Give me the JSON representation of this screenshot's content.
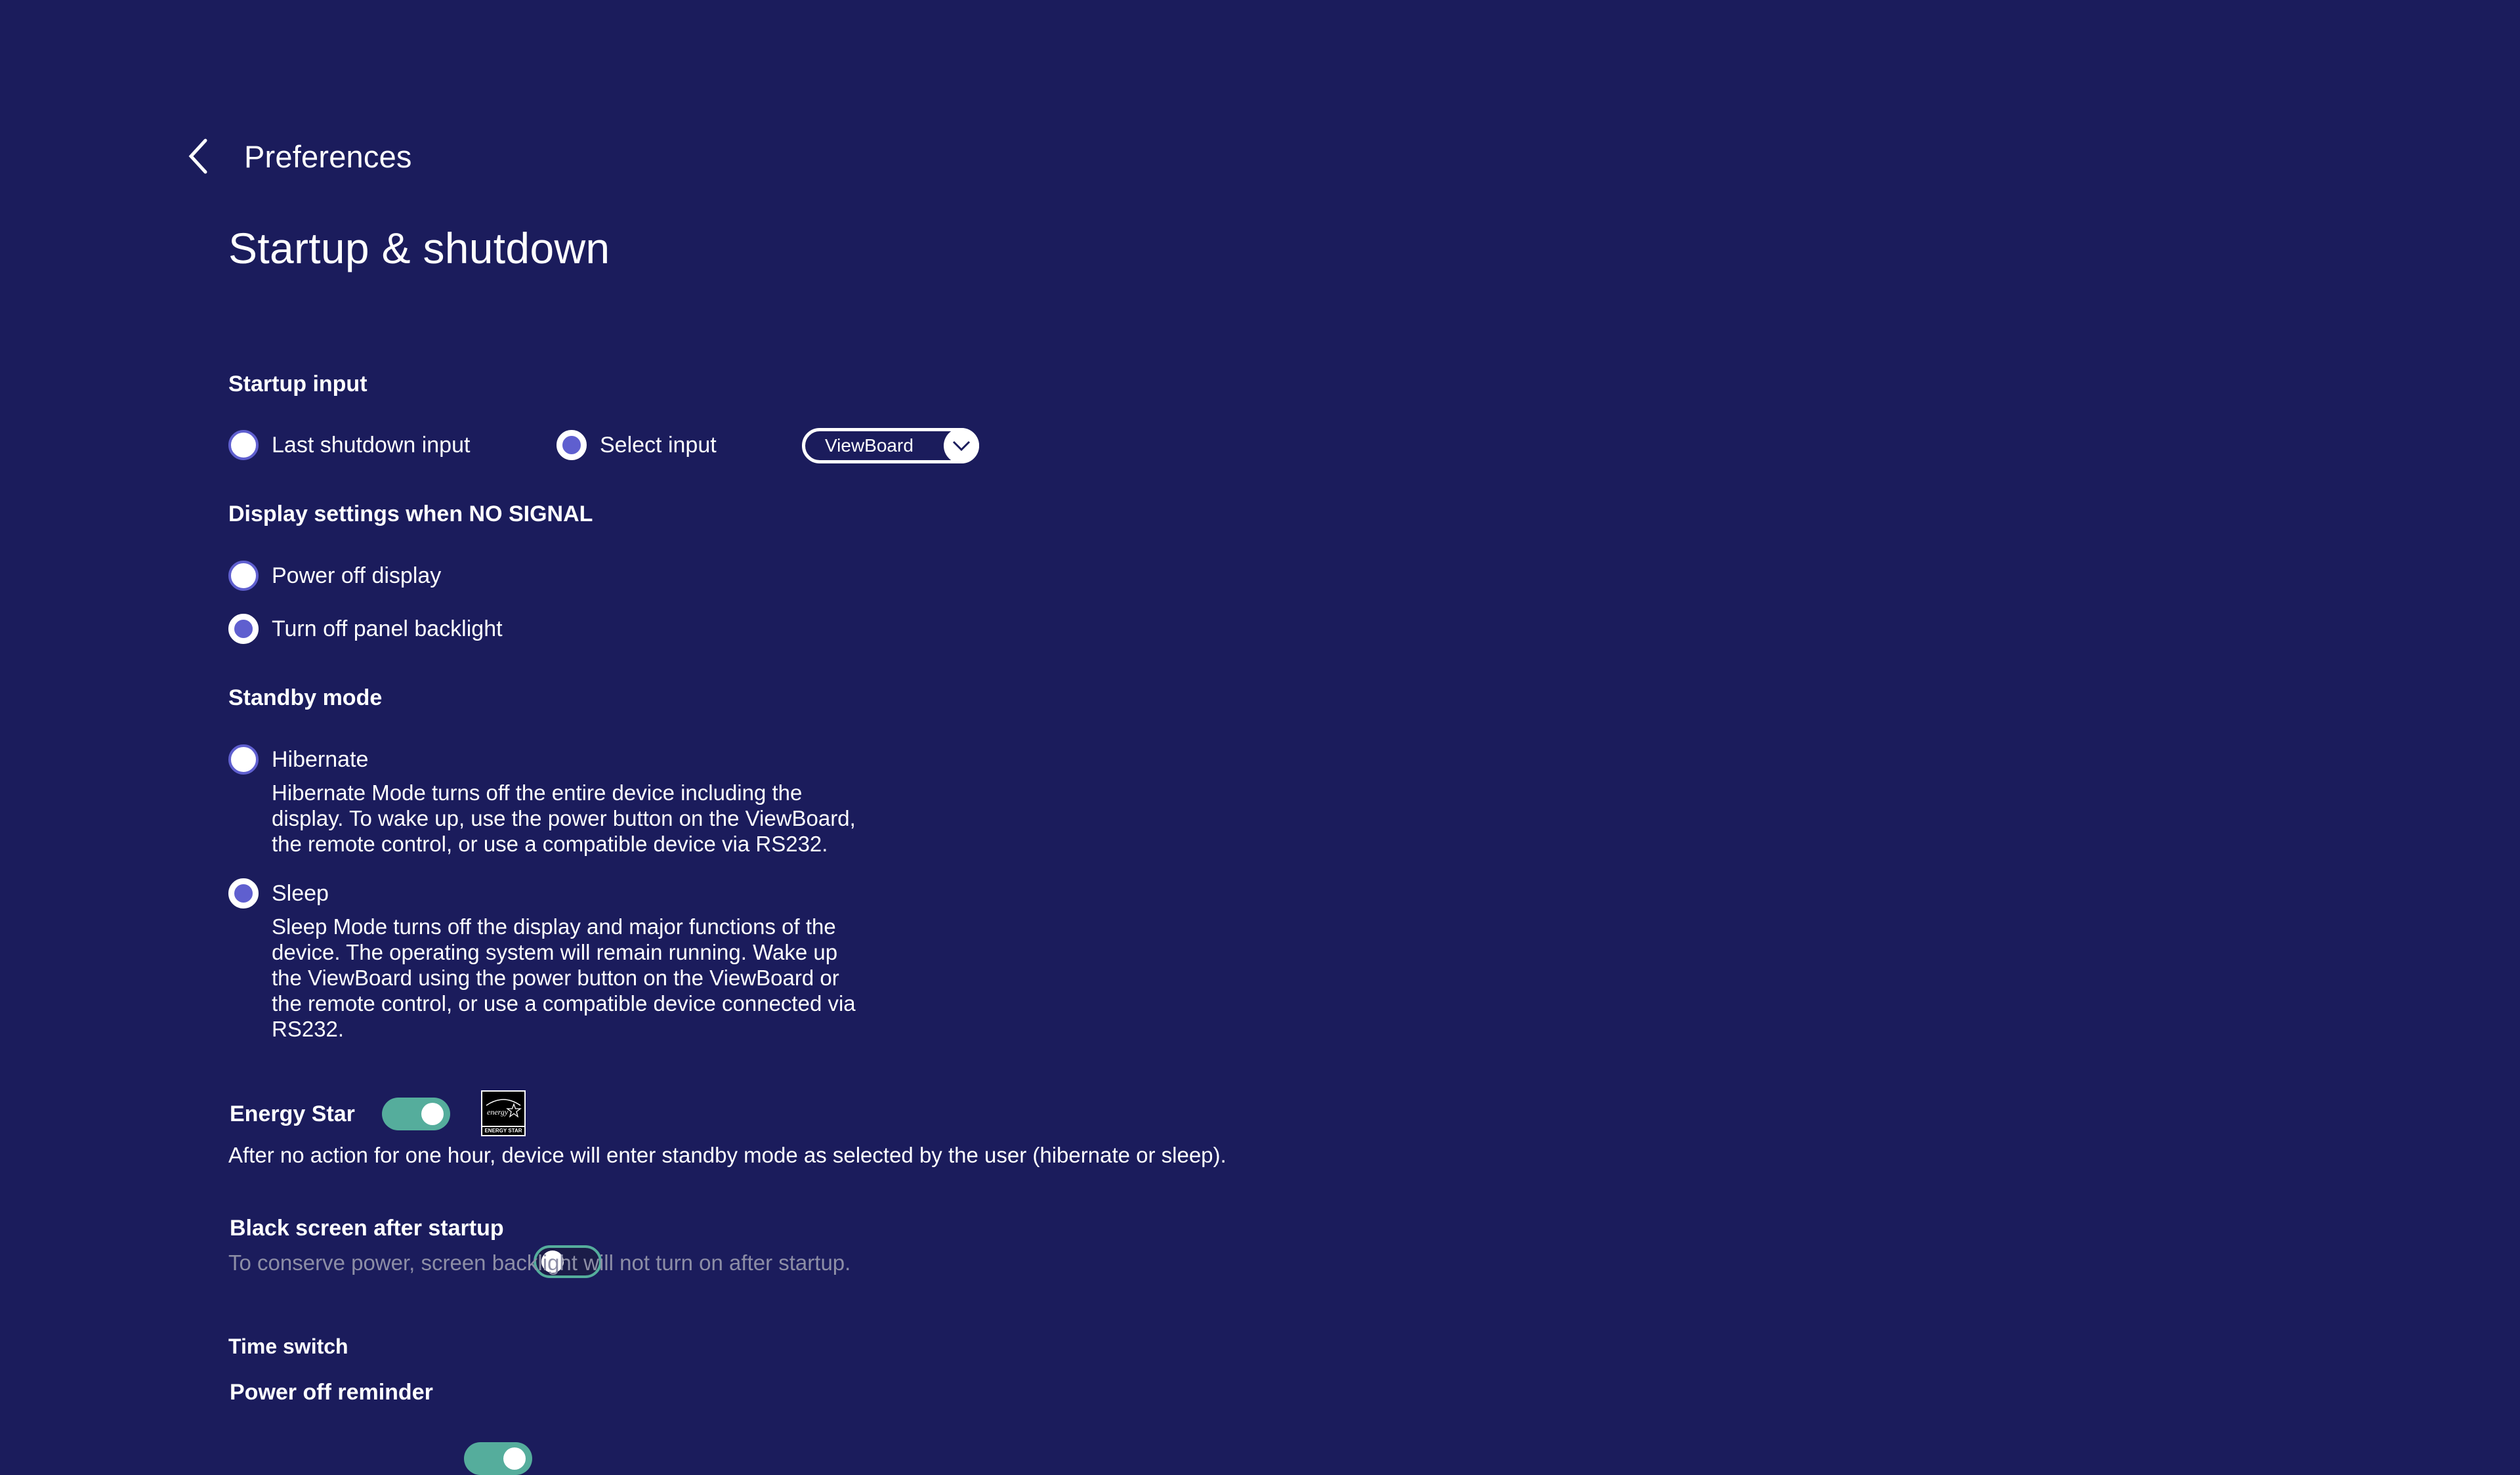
{
  "header": {
    "back_label": "Preferences",
    "title": "Startup & shutdown"
  },
  "startup_input": {
    "heading": "Startup input",
    "options": [
      {
        "label": "Last shutdown input",
        "selected": false
      },
      {
        "label": "Select input",
        "selected": true
      }
    ],
    "dropdown": {
      "value": "ViewBoard",
      "icon": "chevron-down-icon"
    }
  },
  "no_signal": {
    "heading": "Display settings when NO SIGNAL",
    "options": [
      {
        "label": "Power off display",
        "selected": false
      },
      {
        "label": "Turn off panel backlight",
        "selected": true
      }
    ]
  },
  "standby": {
    "heading": "Standby mode",
    "options": [
      {
        "label": "Hibernate",
        "selected": false,
        "description_lines": [
          "Hibernate Mode turns off the entire device including the",
          "display. To wake up, use the power button on the ViewBoard,",
          "the remote control, or use a compatible device via RS232."
        ]
      },
      {
        "label": "Sleep",
        "selected": true,
        "description_lines": [
          "Sleep Mode turns off the display and major functions of the",
          "device. The operating system will remain running. Wake up",
          "the ViewBoard using the power button on the ViewBoard or",
          "the remote control, or use a compatible device connected via",
          "RS232."
        ]
      }
    ]
  },
  "energy_star": {
    "label": "Energy Star",
    "enabled": true,
    "logo_script": "energy",
    "logo_caption": "ENERGY STAR",
    "description": "After no action for one hour, device will enter standby mode as selected by the user (hibernate or sleep)."
  },
  "black_screen": {
    "label": "Black screen after startup",
    "enabled": false,
    "description": "To conserve power, screen backlight will not turn on after startup."
  },
  "time_switch": {
    "heading": "Time switch",
    "power_off_reminder": {
      "label": "Power off reminder",
      "enabled": true
    }
  },
  "colors": {
    "background": "#1b1c5c",
    "radio_accent": "#5f5fcf",
    "toggle_on": "#55ad9c",
    "muted_text": "#8d8ea6"
  }
}
